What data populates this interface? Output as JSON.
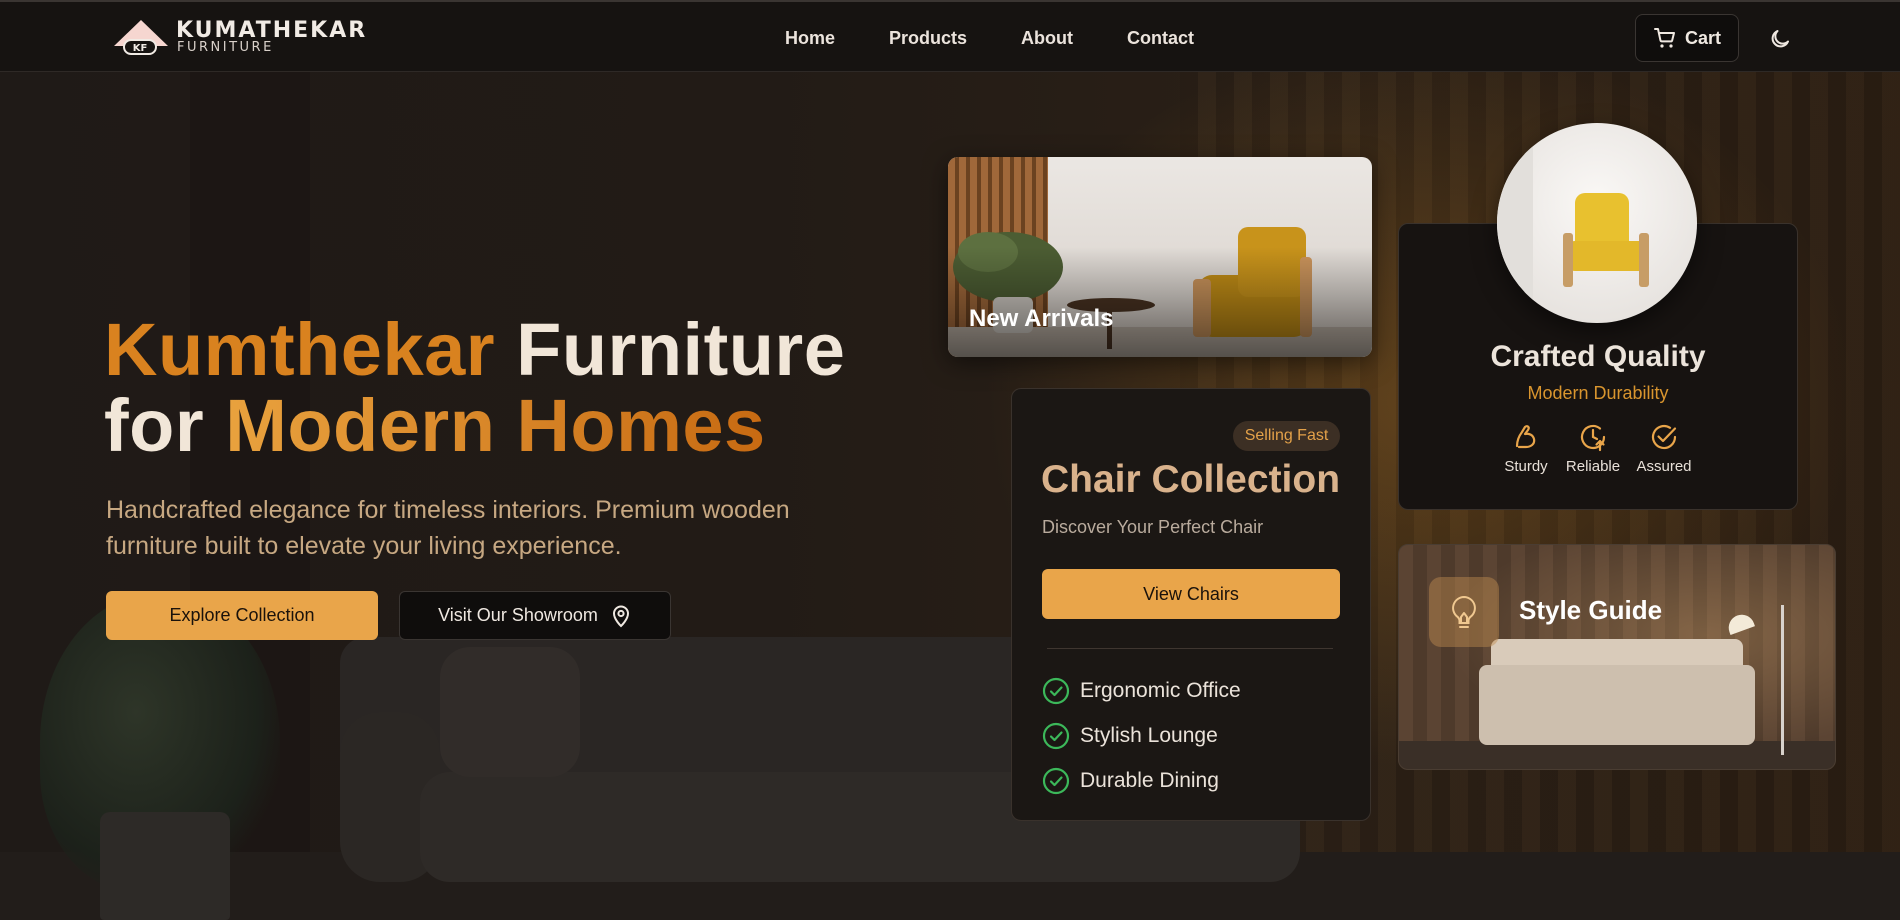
{
  "brand": {
    "name": "KUMATHEKAR",
    "tagline": "FURNITURE",
    "mark": "KF"
  },
  "nav": {
    "links": [
      "Home",
      "Products",
      "About",
      "Contact"
    ],
    "cart_label": "Cart"
  },
  "hero": {
    "title_part1": "Kumthekar",
    "title_part2": " Furniture",
    "title_part3": "for ",
    "title_part4": "Modern Homes",
    "subtitle": "Handcrafted elegance for timeless interiors. Premium wooden furniture built to elevate your living experience.",
    "primary_cta": "Explore Collection",
    "secondary_cta": "Visit Our Showroom"
  },
  "cards": {
    "new_arrivals": {
      "label": "New Arrivals"
    },
    "quality": {
      "title": "Crafted Quality",
      "subtitle": "Modern Durability",
      "features": [
        {
          "label": "Sturdy",
          "icon": "flexed-arm-icon"
        },
        {
          "label": "Reliable",
          "icon": "clock-arrow-icon"
        },
        {
          "label": "Assured",
          "icon": "check-circle-icon"
        }
      ]
    },
    "chairs": {
      "badge": "Selling Fast",
      "title": "Chair Collection",
      "subtitle": "Discover Your Perfect Chair",
      "cta": "View Chairs",
      "items": [
        "Ergonomic Office",
        "Stylish Lounge",
        "Durable Dining"
      ]
    },
    "style_guide": {
      "label": "Style Guide",
      "icon": "lightbulb-icon"
    }
  },
  "colors": {
    "accent": "#e9a54a",
    "brand_orange": "#d9821f",
    "check_green": "#3cb85a",
    "background": "#1b1613"
  }
}
